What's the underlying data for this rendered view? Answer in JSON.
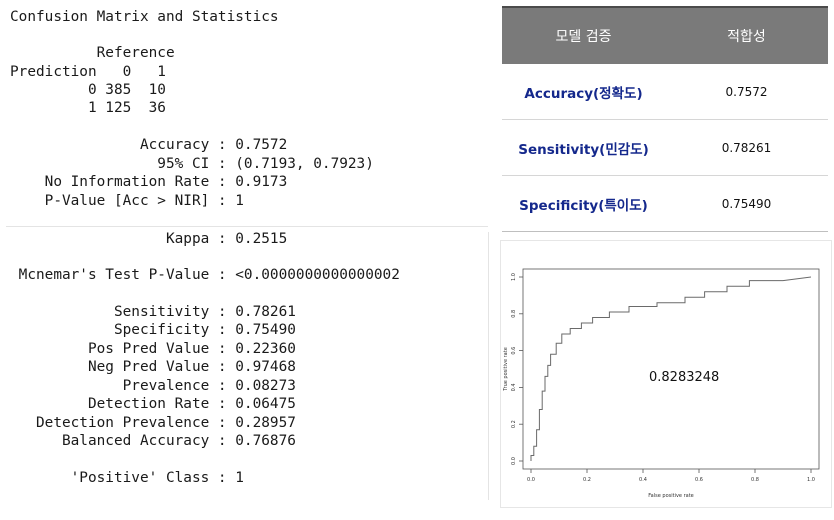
{
  "console": {
    "lines": [
      "Confusion Matrix and Statistics",
      "",
      "          Reference",
      "Prediction   0   1",
      "         0 385  10",
      "         1 125  36",
      "",
      "               Accuracy : 0.7572",
      "                 95% CI : (0.7193, 0.7923)",
      "    No Information Rate : 0.9173",
      "    P-Value [Acc > NIR] : 1",
      "",
      "                  Kappa : 0.2515",
      "",
      " Mcnemar's Test P-Value : <0.0000000000000002",
      "",
      "            Sensitivity : 0.78261",
      "            Specificity : 0.75490",
      "         Pos Pred Value : 0.22360",
      "         Neg Pred Value : 0.97468",
      "             Prevalence : 0.08273",
      "         Detection Rate : 0.06475",
      "   Detection Prevalence : 0.28957",
      "      Balanced Accuracy : 0.76876",
      "",
      "       'Positive' Class : 1"
    ]
  },
  "validation_table": {
    "headers": [
      "모델 검증",
      "적합성"
    ],
    "rows": [
      {
        "metric": "Accuracy(정확도)",
        "value": "0.7572"
      },
      {
        "metric": "Sensitivity(민감도)",
        "value": "0.78261"
      },
      {
        "metric": "Specificity(특이도)",
        "value": "0.75490"
      }
    ]
  },
  "chart_data": {
    "type": "line",
    "title": "",
    "xlabel": "False positive rate",
    "ylabel": "True positive rate",
    "xlim": [
      0,
      1
    ],
    "ylim": [
      0,
      1
    ],
    "xticks": [
      "0.0",
      "0.2",
      "0.4",
      "0.6",
      "0.8",
      "1.0"
    ],
    "yticks": [
      "0.0",
      "0.2",
      "0.4",
      "0.6",
      "0.8",
      "1.0"
    ],
    "annotation": "0.8283248",
    "grid": false,
    "series": [
      {
        "x": [
          0.0,
          0.0,
          0.01,
          0.01,
          0.02,
          0.02,
          0.03,
          0.03,
          0.04,
          0.04,
          0.05,
          0.05,
          0.06,
          0.06,
          0.07,
          0.07,
          0.09,
          0.09,
          0.11,
          0.11,
          0.14,
          0.14,
          0.18,
          0.18,
          0.22,
          0.22,
          0.28,
          0.28,
          0.35,
          0.35,
          0.45,
          0.45,
          0.55,
          0.55,
          0.62,
          0.62,
          0.7,
          0.7,
          0.78,
          0.78,
          0.9,
          1.0
        ],
        "y": [
          0.0,
          0.03,
          0.03,
          0.08,
          0.08,
          0.17,
          0.17,
          0.28,
          0.28,
          0.38,
          0.38,
          0.46,
          0.46,
          0.52,
          0.52,
          0.58,
          0.58,
          0.64,
          0.64,
          0.69,
          0.69,
          0.72,
          0.72,
          0.75,
          0.75,
          0.78,
          0.78,
          0.81,
          0.81,
          0.84,
          0.84,
          0.86,
          0.86,
          0.89,
          0.89,
          0.92,
          0.92,
          0.95,
          0.95,
          0.98,
          0.98,
          1.0
        ]
      }
    ]
  }
}
